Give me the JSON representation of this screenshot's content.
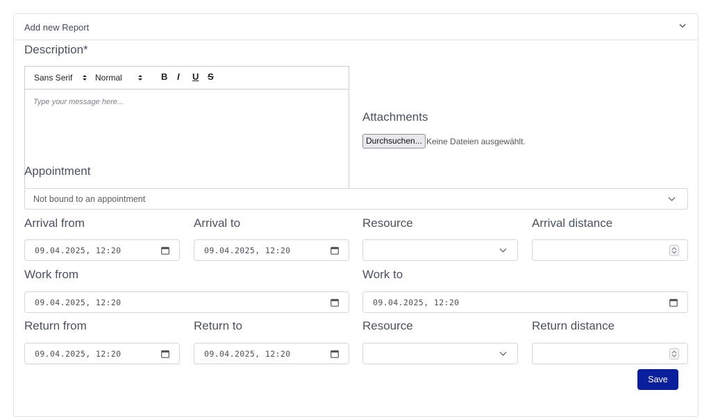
{
  "card": {
    "title": "Add new Report"
  },
  "description": {
    "label": "Description*",
    "font_select": "Sans Serif",
    "size_select": "Normal",
    "bold": "B",
    "italic": "I",
    "underline": "U",
    "strike": "S",
    "placeholder": "Type your message here..."
  },
  "attachments": {
    "label": "Attachments",
    "browse_button": "Durchsuchen...",
    "no_file_text": "Keine Dateien ausgewählt."
  },
  "appointment": {
    "label": "Appointment",
    "selected": "Not bound to an appointment"
  },
  "arrival": {
    "from_label": "Arrival from",
    "from_value": "09.04.2025, 12:20",
    "to_label": "Arrival to",
    "to_value": "09.04.2025, 12:20",
    "resource_label": "Resource",
    "resource_value": "",
    "distance_label": "Arrival distance",
    "distance_value": ""
  },
  "work": {
    "from_label": "Work from",
    "from_value": "09.04.2025, 12:20",
    "to_label": "Work to",
    "to_value": "09.04.2025, 12:20"
  },
  "return": {
    "from_label": "Return from",
    "from_value": "09.04.2025, 12:20",
    "to_label": "Return to",
    "to_value": "09.04.2025, 12:20",
    "resource_label": "Resource",
    "resource_value": "",
    "distance_label": "Return distance",
    "distance_value": ""
  },
  "save_label": "Save",
  "colors": {
    "primary": "#0a1f9c",
    "border": "#d3d6db",
    "text": "#4a5160"
  },
  "icons": [
    "chevron-down-icon",
    "calendar-icon",
    "spinner-icon",
    "select-arrows-icon"
  ]
}
